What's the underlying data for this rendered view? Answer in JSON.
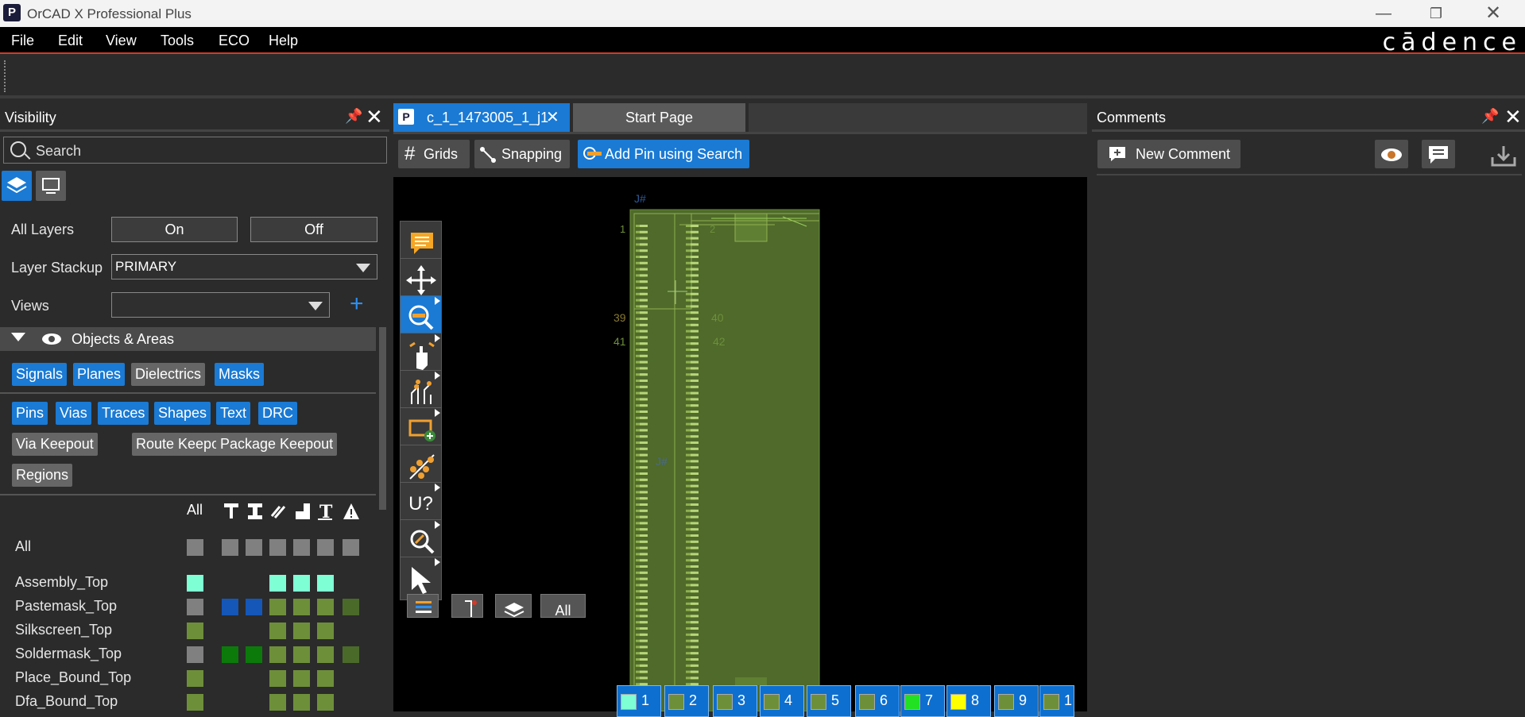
{
  "app": {
    "title": "OrCAD X Professional Plus",
    "brand": "cādence"
  },
  "menu": [
    "File",
    "Edit",
    "View",
    "Tools",
    "ECO",
    "Help"
  ],
  "visibility": {
    "title": "Visibility",
    "search_placeholder": "Search",
    "all_layers_label": "All Layers",
    "on_label": "On",
    "off_label": "Off",
    "layer_stackup_label": "Layer Stackup",
    "layer_stackup_value": "PRIMARY",
    "views_label": "Views",
    "views_value": "",
    "objects_header": "Objects & Areas",
    "chips_row1": [
      {
        "label": "Signals",
        "on": true
      },
      {
        "label": "Planes",
        "on": true
      },
      {
        "label": "Dielectrics",
        "on": false
      },
      {
        "label": "Masks",
        "on": true
      }
    ],
    "chips_row2": [
      {
        "label": "Pins",
        "on": true
      },
      {
        "label": "Vias",
        "on": true
      },
      {
        "label": "Traces",
        "on": true
      },
      {
        "label": "Shapes",
        "on": true
      },
      {
        "label": "Text",
        "on": true
      },
      {
        "label": "DRC",
        "on": true
      }
    ],
    "chips_row3": [
      {
        "label": "Via Keepout",
        "on": false
      },
      {
        "label": "Route Keepout",
        "on": false
      },
      {
        "label": "Package Keepout",
        "on": false
      }
    ],
    "chips_row4": [
      {
        "label": "Regions",
        "on": false
      }
    ],
    "column_all_label": "All",
    "layers": [
      {
        "name": "All",
        "colors": [
          "#808080",
          "#808080",
          "#808080",
          "#808080",
          "#808080",
          "#808080",
          "#808080"
        ]
      },
      {
        "name": "Assembly_Top",
        "colors": [
          "#7fffd4",
          "",
          "",
          "#7fffd4",
          "#7fffd4",
          "#7fffd4",
          ""
        ]
      },
      {
        "name": "Pastemask_Top",
        "colors": [
          "#808080",
          "#1457b8",
          "#1457b8",
          "#6e8f3a",
          "#6e8f3a",
          "#6e8f3a",
          "#4a6a2a"
        ]
      },
      {
        "name": "Silkscreen_Top",
        "colors": [
          "#6e8f3a",
          "",
          "",
          "#6e8f3a",
          "#6e8f3a",
          "#6e8f3a",
          ""
        ]
      },
      {
        "name": "Soldermask_Top",
        "colors": [
          "#808080",
          "#0b7a0b",
          "#0b7a0b",
          "#6e8f3a",
          "#6e8f3a",
          "#6e8f3a",
          "#4a6a2a"
        ]
      },
      {
        "name": "Place_Bound_Top",
        "colors": [
          "#6e8f3a",
          "",
          "",
          "#6e8f3a",
          "#6e8f3a",
          "#6e8f3a",
          ""
        ]
      },
      {
        "name": "Dfa_Bound_Top",
        "colors": [
          "#6e8f3a",
          "",
          "",
          "#6e8f3a",
          "#6e8f3a",
          "#6e8f3a",
          ""
        ]
      }
    ]
  },
  "tabs": {
    "active": "c_1_1473005_1_j1",
    "inactive": "Start Page"
  },
  "doc_toolbar": {
    "grids": "Grids",
    "snapping": "Snapping",
    "add_pin": "Add Pin using Search"
  },
  "canvas": {
    "refdes_top": "J#",
    "refdes_mid": "J#",
    "pin1": "1",
    "pin2": "2",
    "pin39": "39",
    "pin40": "40",
    "pin41": "41",
    "pin42": "42",
    "u_label": "U?"
  },
  "layer_bar": {
    "all_label": "All",
    "layers": [
      {
        "num": "1",
        "color": "#7fffd4"
      },
      {
        "num": "2",
        "color": "#6e8f3a"
      },
      {
        "num": "3",
        "color": "#6e8f3a"
      },
      {
        "num": "4",
        "color": "#6e8f3a"
      },
      {
        "num": "5",
        "color": "#6e8f3a"
      },
      {
        "num": "6",
        "color": "#6e8f3a"
      },
      {
        "num": "7",
        "color": "#22e022"
      },
      {
        "num": "8",
        "color": "#ffff00"
      },
      {
        "num": "9",
        "color": "#6e8f3a"
      },
      {
        "num": "1",
        "color": "#6e8f3a"
      }
    ]
  },
  "comments": {
    "title": "Comments",
    "new_comment": "New Comment"
  }
}
